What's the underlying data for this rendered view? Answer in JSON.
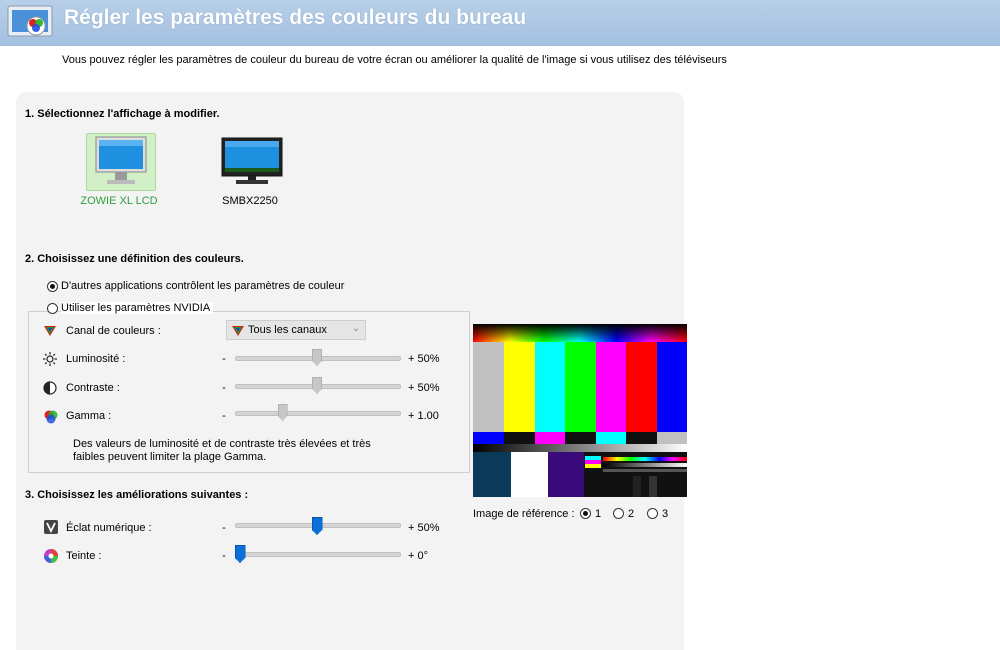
{
  "header": {
    "title": "Régler les paramètres des couleurs du bureau",
    "description": "Vous pouvez régler les paramètres de couleur du bureau de votre écran ou améliorer la qualité de l'image si vous utilisez des téléviseurs"
  },
  "section1": {
    "title": "1. Sélectionnez l'affichage à modifier.",
    "displays": [
      {
        "label": "ZOWIE XL LCD",
        "selected": true
      },
      {
        "label": "SMBX2250",
        "selected": false
      }
    ]
  },
  "section2": {
    "title": "2. Choisissez une définition des couleurs.",
    "option_other_apps": "D'autres applications contrôlent les paramètres de couleur",
    "option_nvidia": "Utiliser les paramètres NVIDIA",
    "selected_option": "other_apps",
    "channel_label": "Canal de couleurs :",
    "channel_value": "Tous les canaux",
    "brightness": {
      "label": "Luminosité :",
      "minus": "-",
      "value": "+ 50%",
      "level": 0.5
    },
    "contrast": {
      "label": "Contraste :",
      "minus": "-",
      "value": "+ 50%",
      "level": 0.5
    },
    "gamma": {
      "label": "Gamma :",
      "minus": "-",
      "value": "+ 1.00",
      "level": 0.29
    },
    "note_line1": "Des valeurs de luminosité et de contraste très élevées et très",
    "note_line2": "faibles peuvent limiter la plage Gamma."
  },
  "section3": {
    "title": "3. Choisissez les améliorations suivantes :",
    "digital_vibrance": {
      "label": "Éclat numérique :",
      "minus": "-",
      "value": "+ 50%",
      "level": 0.5
    },
    "hue": {
      "label": "Teinte :",
      "minus": "-",
      "value": "+ 0°",
      "level": 0.0
    }
  },
  "reference": {
    "label": "Image de référence :",
    "options": [
      "1",
      "2",
      "3"
    ],
    "selected": "1"
  },
  "colors": {
    "header_bg": "#a9c4e2",
    "selected_display_bg": "#d2f0c8",
    "selected_display_text": "#2f9e3c",
    "slider_thumb_blue": "#0a6fd6"
  }
}
